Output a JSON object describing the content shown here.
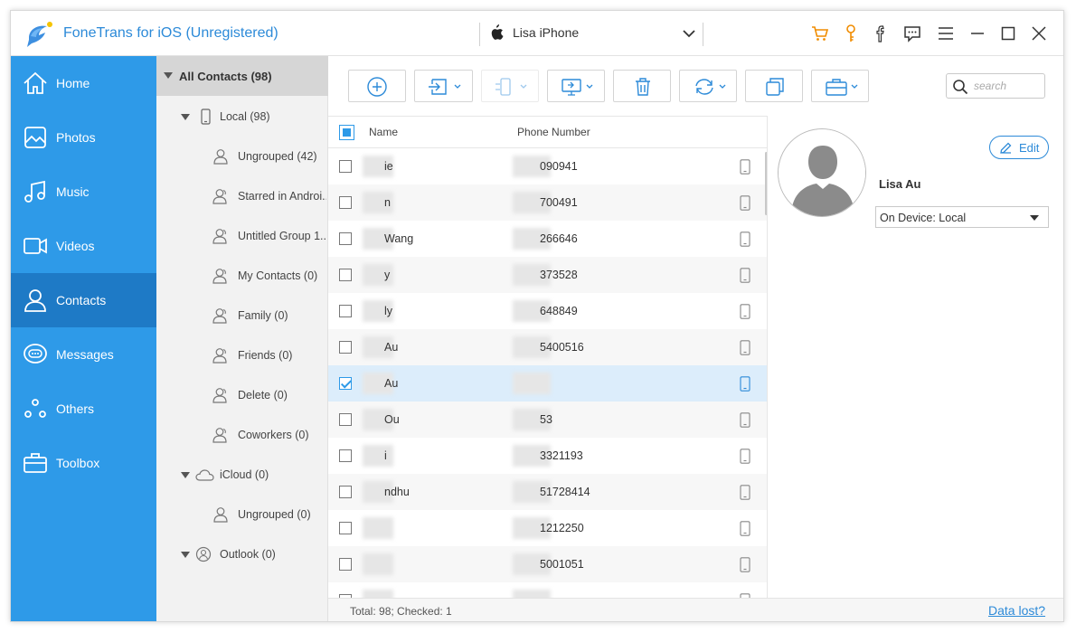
{
  "app": {
    "title": "FoneTrans for iOS (Unregistered)",
    "device_name": "Lisa iPhone",
    "accent_color": "#2e9ae8",
    "icons": [
      "cart-icon",
      "key-icon",
      "facebook-icon",
      "feedback-icon",
      "menu-icon",
      "minimize-icon",
      "maximize-icon",
      "close-icon"
    ]
  },
  "sidebar": {
    "items": [
      {
        "label": "Home",
        "icon": "home-icon"
      },
      {
        "label": "Photos",
        "icon": "photos-icon"
      },
      {
        "label": "Music",
        "icon": "music-icon"
      },
      {
        "label": "Videos",
        "icon": "videos-icon"
      },
      {
        "label": "Contacts",
        "icon": "contacts-icon"
      },
      {
        "label": "Messages",
        "icon": "messages-icon"
      },
      {
        "label": "Others",
        "icon": "others-icon"
      },
      {
        "label": "Toolbox",
        "icon": "toolbox-icon"
      }
    ],
    "active": "Contacts"
  },
  "groups": {
    "all": "All Contacts  (98)",
    "local": "Local  (98)",
    "local_items": [
      "Ungrouped  (42)",
      "Starred in Androi...",
      "Untitled Group 1...",
      "My Contacts  (0)",
      "Family  (0)",
      "Friends  (0)",
      "Delete  (0)",
      "Coworkers  (0)"
    ],
    "icloud": "iCloud  (0)",
    "icloud_items": [
      "Ungrouped  (0)"
    ],
    "outlook": "Outlook  (0)"
  },
  "toolbar": {
    "search_placeholder": "search",
    "buttons": [
      "add-icon",
      "import-icon",
      "export-to-device-icon",
      "export-to-pc-icon",
      "delete-icon",
      "sync-icon",
      "duplicate-icon",
      "toolbox-icon"
    ]
  },
  "list": {
    "col_name": "Name",
    "col_phone": "Phone Number",
    "rows": [
      {
        "name": "ie",
        "phone": "090941",
        "checked": false
      },
      {
        "name": "n",
        "phone": "700491",
        "checked": false
      },
      {
        "name": "Wang",
        "phone": "266646",
        "checked": false
      },
      {
        "name": "y",
        "phone": "373528",
        "checked": false
      },
      {
        "name": "ly",
        "phone": "648849",
        "checked": false
      },
      {
        "name": "Au",
        "phone": "5400516",
        "checked": false
      },
      {
        "name": "Au",
        "phone": "",
        "checked": true
      },
      {
        "name": "Ou",
        "phone": "53",
        "checked": false
      },
      {
        "name": "i",
        "phone": "3321193",
        "checked": false
      },
      {
        "name": "ndhu",
        "phone": "51728414",
        "checked": false
      },
      {
        "name": "",
        "phone": "1212250",
        "checked": false
      },
      {
        "name": "",
        "phone": "5001051",
        "checked": false
      },
      {
        "name": "",
        "phone": "",
        "checked": false
      }
    ]
  },
  "status": {
    "summary": "Total: 98; Checked: 1",
    "data_lost": "Data lost?"
  },
  "detail": {
    "edit_label": "Edit",
    "contact_name": "Lisa Au",
    "device_option": "On Device: Local"
  }
}
